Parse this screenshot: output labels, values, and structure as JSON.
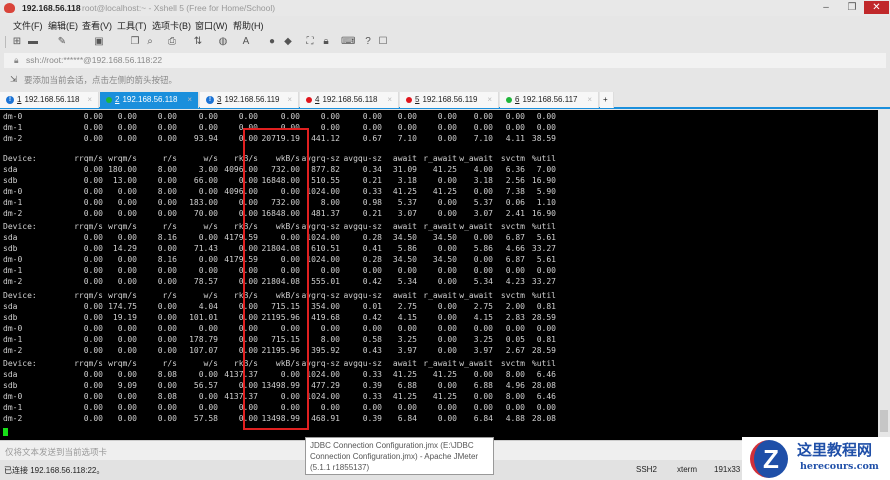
{
  "window": {
    "host": "192.168.56.118",
    "title": "root@localhost:~ - Xshell 5 (Free for Home/School)"
  },
  "menu": [
    "文件(F)",
    "编辑(E)",
    "查看(V)",
    "工具(T)",
    "选项卡(B)",
    "窗口(W)",
    "帮助(H)"
  ],
  "address": "ssh://root:******@192.168.56.118:22",
  "hint": "要添加当前会话，点击左侧的箭头按钮。",
  "tabs": [
    {
      "num": "1",
      "label": "192.168.56.118",
      "status": "info"
    },
    {
      "num": "2",
      "label": "192.168.56.118",
      "status": "green",
      "active": true
    },
    {
      "num": "3",
      "label": "192.168.56.119",
      "status": "info"
    },
    {
      "num": "4",
      "label": "192.168.56.118",
      "status": "red"
    },
    {
      "num": "5",
      "label": "192.168.56.119",
      "status": "red"
    },
    {
      "num": "6",
      "label": "192.168.56.117",
      "status": "green"
    }
  ],
  "add_tab": "+",
  "terminal": {
    "top_rows": [
      [
        "dm-0",
        "0.00",
        "0.00",
        "0.00",
        "0.00",
        "0.00",
        "0.00",
        "0.00",
        "0.00",
        "0.00",
        "0.00",
        "0.00",
        "0.00",
        "0.00"
      ],
      [
        "dm-1",
        "0.00",
        "0.00",
        "0.00",
        "0.00",
        "0.00",
        "0.00",
        "0.00",
        "0.00",
        "0.00",
        "0.00",
        "0.00",
        "0.00",
        "0.00"
      ],
      [
        "dm-2",
        "0.00",
        "0.00",
        "0.00",
        "93.94",
        "0.00",
        "20719.19",
        "441.12",
        "0.67",
        "7.10",
        "0.00",
        "7.10",
        "4.11",
        "38.59"
      ]
    ],
    "header": [
      "Device:",
      "rrqm/s",
      "wrqm/s",
      "r/s",
      "w/s",
      "rkB/s",
      "wkB/s",
      "avgrq-sz",
      "avgqu-sz",
      "await",
      "r_await",
      "w_await",
      "svctm",
      "%util"
    ],
    "blocks": [
      [
        [
          "sda",
          "0.00",
          "180.00",
          "8.00",
          "3.00",
          "4096.00",
          "732.00",
          "877.82",
          "0.34",
          "31.09",
          "41.25",
          "4.00",
          "6.36",
          "7.00"
        ],
        [
          "sdb",
          "0.00",
          "13.00",
          "0.00",
          "66.00",
          "0.00",
          "16848.00",
          "510.55",
          "0.21",
          "3.18",
          "0.00",
          "3.18",
          "2.56",
          "16.90"
        ],
        [
          "dm-0",
          "0.00",
          "0.00",
          "8.00",
          "0.00",
          "4096.00",
          "0.00",
          "1024.00",
          "0.33",
          "41.25",
          "41.25",
          "0.00",
          "7.38",
          "5.90"
        ],
        [
          "dm-1",
          "0.00",
          "0.00",
          "0.00",
          "183.00",
          "0.00",
          "732.00",
          "8.00",
          "0.98",
          "5.37",
          "0.00",
          "5.37",
          "0.06",
          "1.10"
        ],
        [
          "dm-2",
          "0.00",
          "0.00",
          "0.00",
          "70.00",
          "0.00",
          "16848.00",
          "481.37",
          "0.21",
          "3.07",
          "0.00",
          "3.07",
          "2.41",
          "16.90"
        ]
      ],
      [
        [
          "sda",
          "0.00",
          "0.00",
          "8.16",
          "0.00",
          "4179.59",
          "0.00",
          "1024.00",
          "0.28",
          "34.50",
          "34.50",
          "0.00",
          "6.87",
          "5.61"
        ],
        [
          "sdb",
          "0.00",
          "14.29",
          "0.00",
          "71.43",
          "0.00",
          "21804.08",
          "610.51",
          "0.41",
          "5.86",
          "0.00",
          "5.86",
          "4.66",
          "33.27"
        ],
        [
          "dm-0",
          "0.00",
          "0.00",
          "8.16",
          "0.00",
          "4179.59",
          "0.00",
          "1024.00",
          "0.28",
          "34.50",
          "34.50",
          "0.00",
          "6.87",
          "5.61"
        ],
        [
          "dm-1",
          "0.00",
          "0.00",
          "0.00",
          "0.00",
          "0.00",
          "0.00",
          "0.00",
          "0.00",
          "0.00",
          "0.00",
          "0.00",
          "0.00",
          "0.00"
        ],
        [
          "dm-2",
          "0.00",
          "0.00",
          "0.00",
          "78.57",
          "0.00",
          "21804.08",
          "555.01",
          "0.42",
          "5.34",
          "0.00",
          "5.34",
          "4.23",
          "33.27"
        ]
      ],
      [
        [
          "sda",
          "0.00",
          "174.75",
          "0.00",
          "4.04",
          "0.00",
          "715.15",
          "354.00",
          "0.01",
          "2.75",
          "0.00",
          "2.75",
          "2.00",
          "0.81"
        ],
        [
          "sdb",
          "0.00",
          "19.19",
          "0.00",
          "101.01",
          "0.00",
          "21195.96",
          "419.68",
          "0.42",
          "4.15",
          "0.00",
          "4.15",
          "2.83",
          "28.59"
        ],
        [
          "dm-0",
          "0.00",
          "0.00",
          "0.00",
          "0.00",
          "0.00",
          "0.00",
          "0.00",
          "0.00",
          "0.00",
          "0.00",
          "0.00",
          "0.00",
          "0.00"
        ],
        [
          "dm-1",
          "0.00",
          "0.00",
          "0.00",
          "178.79",
          "0.00",
          "715.15",
          "8.00",
          "0.58",
          "3.25",
          "0.00",
          "3.25",
          "0.05",
          "0.81"
        ],
        [
          "dm-2",
          "0.00",
          "0.00",
          "0.00",
          "107.07",
          "0.00",
          "21195.96",
          "395.92",
          "0.43",
          "3.97",
          "0.00",
          "3.97",
          "2.67",
          "28.59"
        ]
      ],
      [
        [
          "sda",
          "0.00",
          "0.00",
          "8.08",
          "0.00",
          "4137.37",
          "0.00",
          "1024.00",
          "0.33",
          "41.25",
          "41.25",
          "0.00",
          "8.00",
          "6.46"
        ],
        [
          "sdb",
          "0.00",
          "9.09",
          "0.00",
          "56.57",
          "0.00",
          "13498.99",
          "477.29",
          "0.39",
          "6.88",
          "0.00",
          "6.88",
          "4.96",
          "28.08"
        ],
        [
          "dm-0",
          "0.00",
          "0.00",
          "8.08",
          "0.00",
          "4137.37",
          "0.00",
          "1024.00",
          "0.33",
          "41.25",
          "41.25",
          "0.00",
          "8.00",
          "6.46"
        ],
        [
          "dm-1",
          "0.00",
          "0.00",
          "0.00",
          "0.00",
          "0.00",
          "0.00",
          "0.00",
          "0.00",
          "0.00",
          "0.00",
          "0.00",
          "0.00",
          "0.00"
        ],
        [
          "dm-2",
          "0.00",
          "0.00",
          "0.00",
          "57.58",
          "0.00",
          "13498.99",
          "468.91",
          "0.39",
          "6.84",
          "0.00",
          "6.84",
          "4.88",
          "28.08"
        ]
      ]
    ]
  },
  "input_bar": "仅将文本发送到当前选项卡",
  "status": {
    "connected": "已连接 192.168.56.118:22。",
    "protocol": "SSH2",
    "term": "xterm",
    "size": "191x33"
  },
  "tooltip": {
    "line1": "JDBC Connection Configuration.jmx (E:\\JDBC",
    "line2": "Connection Configuration.jmx) - Apache JMeter",
    "line3": "(5.1.1 r1855137)"
  },
  "watermark": {
    "cn": "这里教程网",
    "en": "herecours.com",
    "letter": "Z"
  },
  "colors": {
    "accent": "#1a8fdc",
    "highlight_box": "#e02020",
    "cursor": "#17e017"
  }
}
